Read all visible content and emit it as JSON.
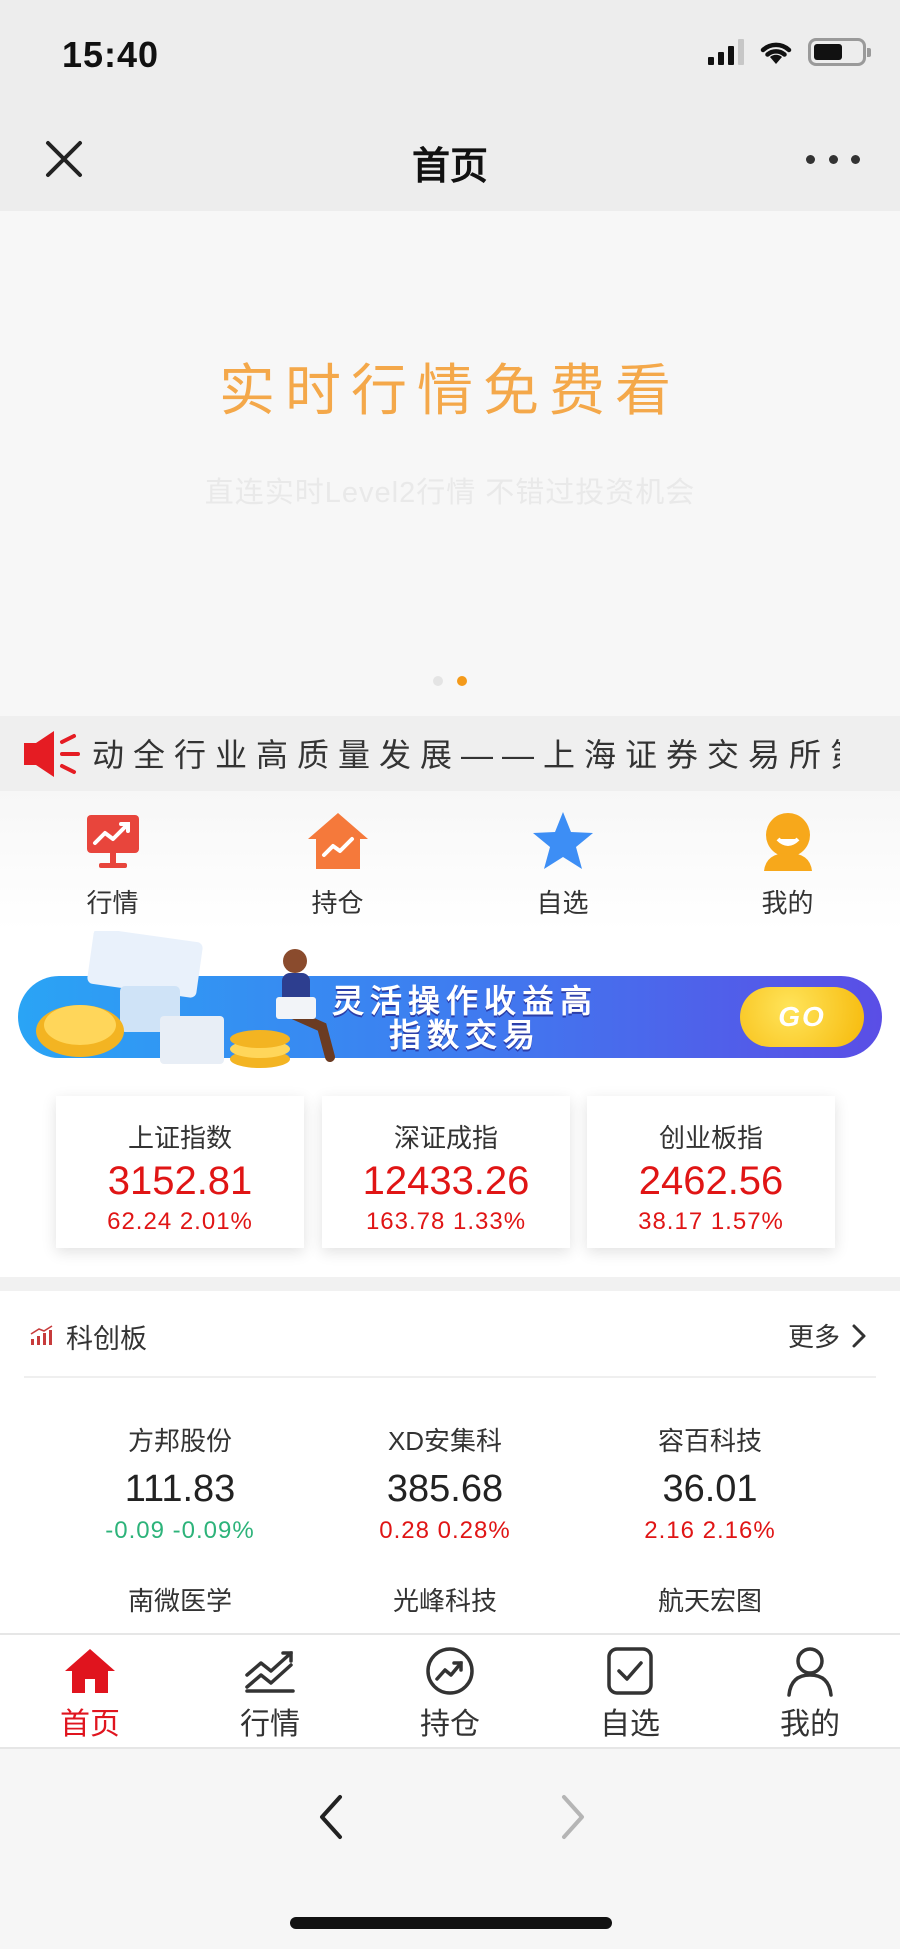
{
  "status_bar": {
    "time": "15:40"
  },
  "nav": {
    "title": "首页"
  },
  "banner": {
    "title": "实时行情免费看",
    "subtitle": "直连实时Level2行情 不错过投资机会"
  },
  "marquee": {
    "text": "动全行业高质量发展——上海证券交易所第"
  },
  "quick_menu": [
    {
      "label": "行情",
      "icon": "chart-monitor-icon",
      "color": "#e8453c"
    },
    {
      "label": "持仓",
      "icon": "house-chart-icon",
      "color": "#f5793b"
    },
    {
      "label": "自选",
      "icon": "star-icon",
      "color": "#3d8ef5"
    },
    {
      "label": "我的",
      "icon": "user-icon",
      "color": "#f7a81b"
    }
  ],
  "ad": {
    "line1": "灵活操作收益高",
    "line2": "指数交易",
    "go": "GO"
  },
  "indices": [
    {
      "name": "上证指数",
      "value": "3152.81",
      "change": "62.24 2.01%"
    },
    {
      "name": "深证成指",
      "value": "12433.26",
      "change": "163.78 1.33%"
    },
    {
      "name": "创业板指",
      "value": "2462.56",
      "change": "38.17 1.57%"
    }
  ],
  "kechuang": {
    "title": "科创板",
    "more": "更多",
    "stocks": [
      {
        "name": "方邦股份",
        "price": "111.83",
        "change": "-0.09 -0.09%",
        "direction": "down"
      },
      {
        "name": "XD安集科",
        "price": "385.68",
        "change": "0.28 0.28%",
        "direction": "up"
      },
      {
        "name": "容百科技",
        "price": "36.01",
        "change": "2.16 2.16%",
        "direction": "up"
      },
      {
        "name": "南微医学",
        "price": "",
        "change": "",
        "direction": ""
      },
      {
        "name": "光峰科技",
        "price": "",
        "change": "",
        "direction": ""
      },
      {
        "name": "航天宏图",
        "price": "",
        "change": "",
        "direction": ""
      }
    ]
  },
  "tabs": [
    {
      "label": "首页",
      "icon": "home-icon",
      "active": true
    },
    {
      "label": "行情",
      "icon": "trend-chart-icon",
      "active": false
    },
    {
      "label": "持仓",
      "icon": "trend-circle-icon",
      "active": false
    },
    {
      "label": "自选",
      "icon": "checkbox-icon",
      "active": false
    },
    {
      "label": "我的",
      "icon": "user-outline-icon",
      "active": false
    }
  ],
  "colors": {
    "accent_red": "#e0141e",
    "up": "#e01515",
    "down": "#2db37a",
    "banner_orange": "#f4a84a"
  }
}
